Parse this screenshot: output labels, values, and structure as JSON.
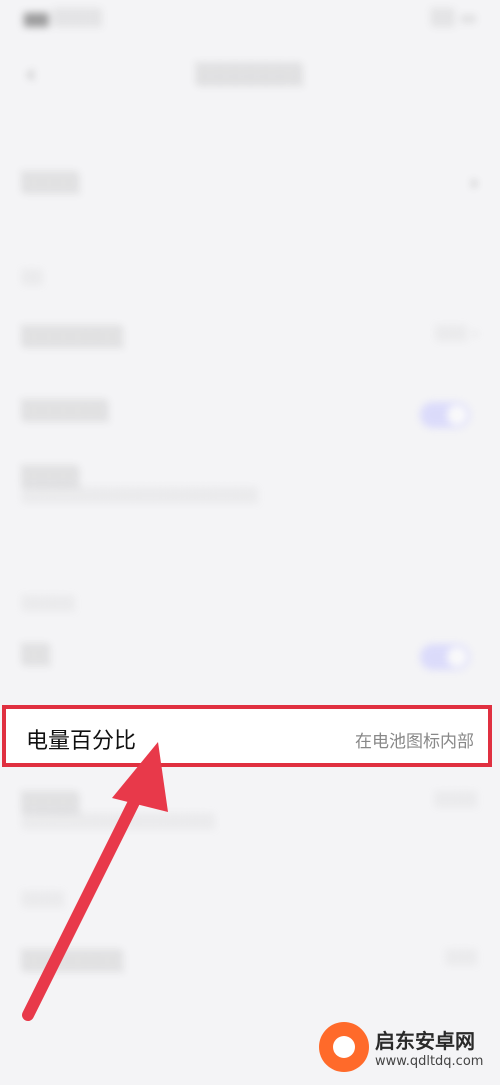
{
  "status_bar": {
    "left": "Status",
    "right": "Status"
  },
  "header": {
    "title": "Settings",
    "back_icon": "back-arrow-icon"
  },
  "background_rows": [
    {
      "label": "",
      "value": ""
    },
    {
      "label": "",
      "value": ""
    },
    {
      "label": "",
      "value": ""
    },
    {
      "label": "",
      "value": ""
    },
    {
      "label": "",
      "value": ""
    }
  ],
  "highlighted_row": {
    "label": "电量百分比",
    "value": "在电池图标内部"
  },
  "annotation": {
    "arrow_color": "#e8394a",
    "box_color": "#e03040"
  },
  "watermark": {
    "brand": "启东安卓网",
    "url": "www.qdltdq.com"
  }
}
